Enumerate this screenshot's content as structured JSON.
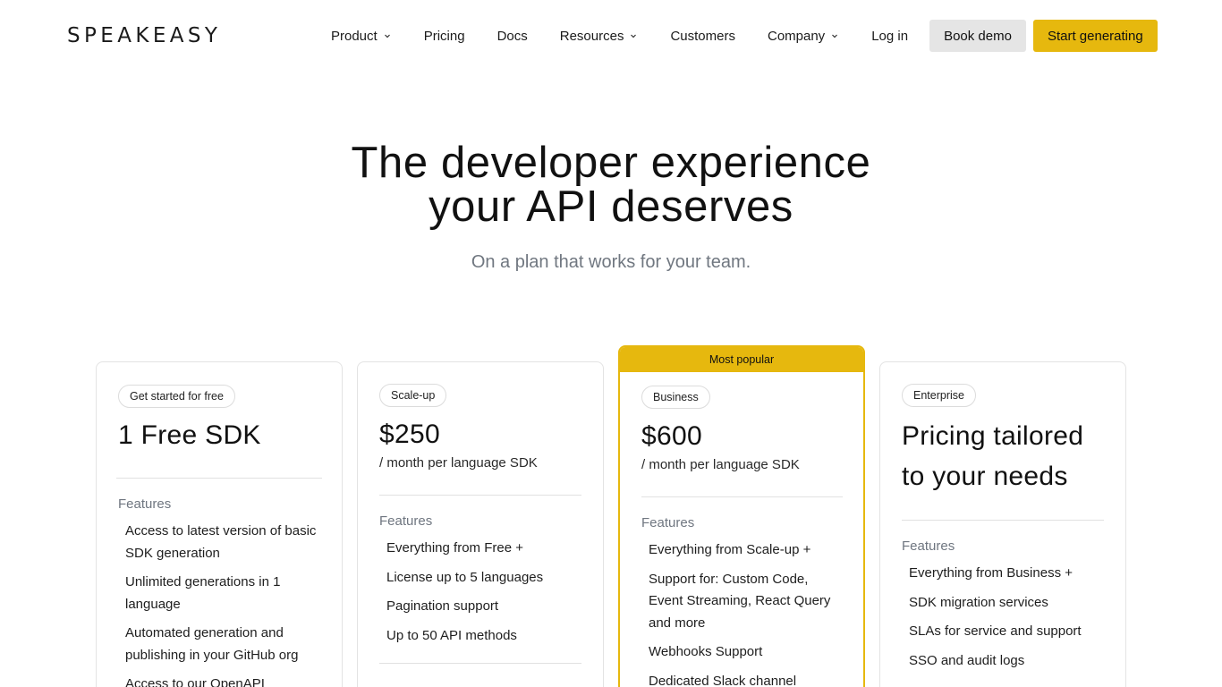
{
  "brand": {
    "logo_text": "SPEAKEASY"
  },
  "nav": {
    "items": [
      {
        "label": "Product",
        "has_dropdown": true
      },
      {
        "label": "Pricing",
        "has_dropdown": false
      },
      {
        "label": "Docs",
        "has_dropdown": false
      },
      {
        "label": "Resources",
        "has_dropdown": true
      },
      {
        "label": "Customers",
        "has_dropdown": false
      },
      {
        "label": "Company",
        "has_dropdown": true
      },
      {
        "label": "Log in",
        "has_dropdown": false
      }
    ],
    "book_demo": "Book demo",
    "start_generating": "Start generating"
  },
  "hero": {
    "title_line1": "The developer experience",
    "title_line2": "your API deserves",
    "subtitle": "On a plan that works for your team."
  },
  "plans": [
    {
      "tag": "Get started for free",
      "price": "1 Free SDK",
      "price_sub": "",
      "features_heading": "Features",
      "features": [
        "Access to latest version of basic SDK generation",
        "Unlimited generations in 1 language",
        "Automated generation and publishing in your GitHub org",
        "Access to our OpenAPI"
      ]
    },
    {
      "tag": "Scale-up",
      "price": "$250",
      "price_sub": "/ month per language SDK",
      "features_heading": "Features",
      "features": [
        "Everything from Free +",
        "License up to 5 languages",
        "Pagination support",
        "Up to 50 API methods"
      ]
    },
    {
      "ribbon": "Most popular",
      "tag": "Business",
      "price": "$600",
      "price_sub": "/ month per language SDK",
      "features_heading": "Features",
      "features": [
        "Everything from Scale-up +",
        "Support for: Custom Code, Event Streaming, React Query and more",
        "Webhooks Support",
        "Dedicated Slack channel"
      ]
    },
    {
      "tag": "Enterprise",
      "price": "Pricing tailored to your needs",
      "price_sub": "",
      "features_heading": "Features",
      "features": [
        "Everything from Business +",
        "SDK migration services",
        "SLAs for service and support",
        "SSO and audit logs"
      ]
    }
  ],
  "colors": {
    "accent": "#e6b80e",
    "secondary_button": "#e5e5e5",
    "muted_text": "#707780",
    "border": "#e3e3e3"
  }
}
